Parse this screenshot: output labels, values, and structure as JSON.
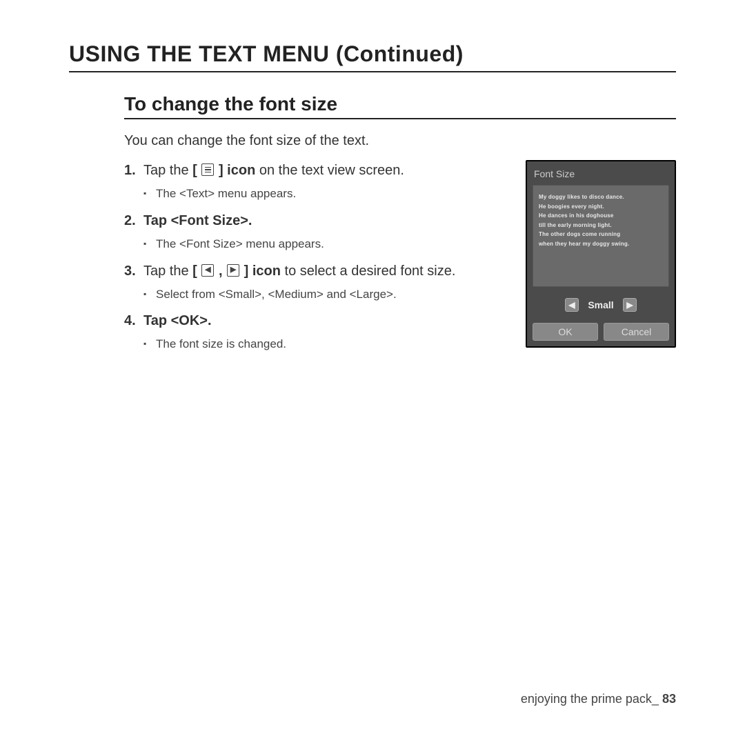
{
  "main_title": "USING THE TEXT MENU (Continued)",
  "sub_title": "To change the font size",
  "intro": "You can change the font size of the text.",
  "steps": {
    "s1_a": "Tap the ",
    "s1_b": " icon",
    "s1_c": " on the text view screen.",
    "s1_bullet": "The <Text> menu appears.",
    "s2": "Tap <Font Size>.",
    "s2_bullet": "The <Font Size> menu appears.",
    "s3_a": "Tap the ",
    "s3_b": " icon",
    "s3_c": " to select a desired font size.",
    "s3_bullet": "Select from <Small>, <Medium> and <Large>.",
    "s4": "Tap <OK>.",
    "s4_bullet": "The font size is changed."
  },
  "device": {
    "title": "Font Size",
    "text_lines": [
      "My doggy likes to disco dance.",
      "He boogies every night.",
      "He dances in his doghouse",
      "till the early morning light.",
      "The other dogs come running",
      "when they hear my doggy swing."
    ],
    "size_value": "Small",
    "ok": "OK",
    "cancel": "Cancel"
  },
  "footer": {
    "section": "enjoying the prime pack_",
    "page": "83"
  }
}
